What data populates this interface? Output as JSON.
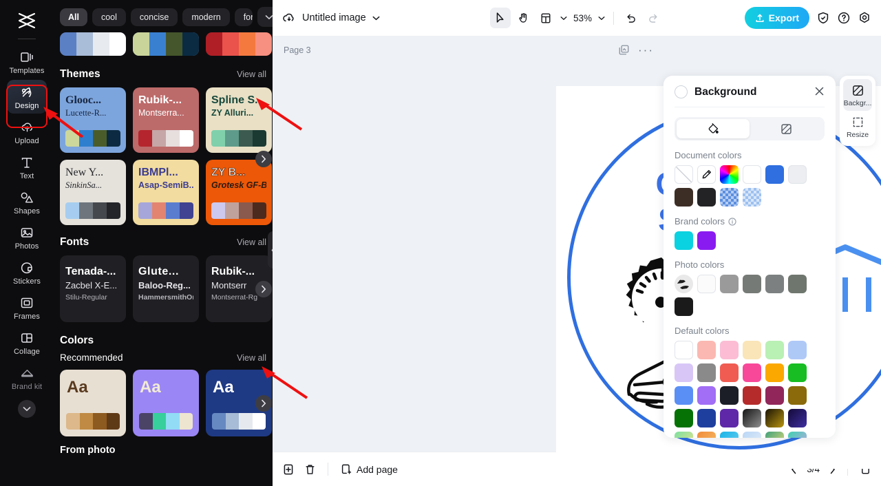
{
  "rail": {
    "logo_icon": "capcut-logo-icon",
    "items": [
      {
        "label": "Templates",
        "icon": "templates-icon",
        "active": false
      },
      {
        "label": "Design",
        "icon": "design-icon",
        "active": true
      },
      {
        "label": "Upload",
        "icon": "upload-cloud-icon",
        "active": false
      },
      {
        "label": "Text",
        "icon": "text-icon",
        "active": false
      },
      {
        "label": "Shapes",
        "icon": "shapes-icon",
        "active": false
      },
      {
        "label": "Photos",
        "icon": "photos-icon",
        "active": false
      },
      {
        "label": "Stickers",
        "icon": "stickers-icon",
        "active": false
      },
      {
        "label": "Frames",
        "icon": "frames-icon",
        "active": false
      },
      {
        "label": "Collage",
        "icon": "collage-icon",
        "active": false
      },
      {
        "label": "Brand kit",
        "icon": "brand-kit-icon",
        "active": false
      }
    ],
    "expand_icon": "chevron-down-icon"
  },
  "panel": {
    "chips": [
      {
        "label": "All",
        "selected": true
      },
      {
        "label": "cool",
        "selected": false
      },
      {
        "label": "concise",
        "selected": false
      },
      {
        "label": "modern",
        "selected": false
      },
      {
        "label": "formal",
        "selected": false
      }
    ],
    "chip_more_icon": "chevron-down-icon",
    "cutoff_cards": [
      {
        "colors": [
          "#5b80c4",
          "#a9bcd8",
          "#e7eaef",
          "#ffffff"
        ],
        "frame": "#27387f"
      },
      {
        "colors": [
          "#c9d49a",
          "#3a80d0",
          "#46562c",
          "#0b2b43"
        ],
        "frame": "#89bbe8"
      },
      {
        "colors": [
          "#b01f26",
          "#e9534c",
          "#f4793f",
          "#f79080"
        ],
        "frame": "#8d1014"
      }
    ],
    "themes": {
      "title": "Themes",
      "view_all": "View all",
      "cards": [
        {
          "name1": "Glooc...",
          "name2": "Lucette-R...",
          "bg": "#7da5dd",
          "fg1": "#17263f",
          "fg2": "#17263f",
          "serif": true,
          "swatch": [
            "#ccd79b",
            "#2f7fcf",
            "#4a5c29",
            "#0c2b42"
          ]
        },
        {
          "name1": "Rubik-...",
          "name2": "Montserra...",
          "bg": "#bd6a6a",
          "fg1": "#ffffff",
          "fg2": "#ffffff",
          "serif": false,
          "swatch": [
            "#b5252d",
            "#c6a6a6",
            "#e7dede",
            "#ffffff"
          ]
        },
        {
          "name1": "Spline S...",
          "name2": "ZY Alluri...",
          "bg": "#e9e0c5",
          "fg1": "#17483c",
          "fg2": "#17483c",
          "serif": false,
          "swatch": [
            "#7fd0ab",
            "#5e9b8a",
            "#3c5a50",
            "#1a3a32"
          ]
        },
        {
          "name1": "New Y...",
          "name2": "SinkinSa...",
          "bg": "#e5e2dc",
          "fg1": "#26262a",
          "fg2": "#26262a",
          "serif": true,
          "swatch": [
            "#a6cdf0",
            "#6e757c",
            "#45484d",
            "#242529"
          ]
        },
        {
          "name1": "IBMPl...",
          "name2": "Asap-SemiB...",
          "bg": "#f2dc9f",
          "fg1": "#3b3c91",
          "fg2": "#3b3c91",
          "serif": false,
          "swatch": [
            "#a6a6da",
            "#e28470",
            "#5a7dd0",
            "#3f4391"
          ]
        },
        {
          "name1": "ZY B...",
          "name2": "Grotesk GF-B...",
          "bg": "#ec5807",
          "fg1": "#f6eee9",
          "fg2": "#2b1a12",
          "serif": false,
          "swatch": [
            "#cdc9ee",
            "#c0a29c",
            "#8a5a4e",
            "#4c2a1e"
          ]
        }
      ],
      "next_icon": "chevron-right-icon"
    },
    "fonts": {
      "title": "Fonts",
      "view_all": "View all",
      "cards": [
        {
          "l1": "Tenada-...",
          "l2": "Zacbel X-E...",
          "l3": "Stilu-Regular"
        },
        {
          "l1": "Glute...",
          "l2": "Baloo-Reg...",
          "l3": "HammersmithOn..."
        },
        {
          "l1": "Rubik-...",
          "l2": "Montserr",
          "l3": "Montserrat-Rg"
        }
      ],
      "next_icon": "chevron-right-icon"
    },
    "colors": {
      "title": "Colors",
      "recommended_label": "Recommended",
      "view_all": "View all",
      "cards": [
        {
          "aa": "Aa",
          "bg": "#e8dfd3",
          "fg": "#5a3b1f",
          "swatch": [
            "#ddb88a",
            "#c08a44",
            "#8d5a20",
            "#5f3a17"
          ]
        },
        {
          "aa": "Aa",
          "bg": "#9b86f5",
          "fg": "#f2ebd6",
          "swatch": [
            "#4b4467",
            "#37cf9b",
            "#92dcf6",
            "#eee5d0"
          ]
        },
        {
          "aa": "Aa",
          "bg": "#1f3a84",
          "fg": "#ffffff",
          "swatch": [
            "#6689c2",
            "#a7bcd6",
            "#e6eaef",
            "#ffffff"
          ]
        }
      ],
      "next_icon": "chevron-right-icon",
      "from_photo": "From photo"
    },
    "collapse_icon": "chevron-left-icon"
  },
  "topbar": {
    "cloud_icon": "cloud-save-icon",
    "doc_title": "Untitled image",
    "title_caret_icon": "chevron-down-icon",
    "tools": [
      {
        "name": "select-tool",
        "icon": "cursor-icon",
        "selected": true
      },
      {
        "name": "hand-tool",
        "icon": "hand-icon",
        "selected": false
      },
      {
        "name": "layout-tool",
        "icon": "layout-icon",
        "selected": false
      }
    ],
    "zoom": "53%",
    "zoom_caret_icon": "chevron-down-icon",
    "undo_icon": "undo-icon",
    "redo_icon": "redo-icon",
    "export_label": "Export",
    "export_icon": "upload-icon",
    "export_color": "#16c4e5",
    "right_icons": [
      "shield-check-icon",
      "help-circle-icon",
      "settings-gear-icon"
    ]
  },
  "canvas": {
    "page_label": "Page 3",
    "duplicate_icon": "duplicate-page-icon",
    "more_icon": "more-horizontal-icon",
    "logo": {
      "title_line1": "Car Garage",
      "title_line2": "Shop Logo",
      "ring_color": "#2f6fe0",
      "text_color": "#3b72e8",
      "garage_color": "#4a90f0",
      "art_icons": [
        "gear-speedometer-icon",
        "sports-car-icon",
        "garage-building-icon"
      ]
    }
  },
  "bottombar": {
    "duplicate_icon": "duplicate-icon",
    "delete_icon": "trash-icon",
    "add_page_label": "Add page",
    "add_page_icon": "add-page-icon",
    "prev_icon": "chevron-left-icon",
    "next_icon": "chevron-right-icon",
    "page_indicator": "3/4",
    "expand_icon": "expand-panel-icon"
  },
  "props": {
    "title": "Background",
    "close_icon": "close-icon",
    "tabs": [
      {
        "name": "fill-tab",
        "icon": "paint-bucket-icon",
        "on": true
      },
      {
        "name": "transparency-tab",
        "icon": "checker-square-icon",
        "on": false
      }
    ],
    "document_colors_label": "Document colors",
    "document_colors": [
      {
        "type": "none",
        "color": "#ffffff"
      },
      {
        "type": "eyedropper",
        "color": "#ffffff"
      },
      {
        "type": "rainbow",
        "color": "rainbow"
      },
      {
        "type": "solid",
        "color": "#ffffff"
      },
      {
        "type": "solid",
        "color": "#2f6fe0"
      },
      {
        "type": "solid",
        "color": "#eceef1"
      },
      {
        "type": "solid",
        "color": "#3d2e25"
      },
      {
        "type": "solid",
        "color": "#232326"
      },
      {
        "type": "checker",
        "color": "#5b8fe0"
      },
      {
        "type": "checker",
        "color": "#9dc0ef"
      }
    ],
    "brand_colors_label": "Brand colors",
    "brand_info_icon": "info-icon",
    "brand_colors": [
      "#0ad2e0",
      "#8a1bf0"
    ],
    "photo_colors_label": "Photo colors",
    "photo_colors": [
      {
        "type": "thumb",
        "color": "#d8d8d8"
      },
      {
        "type": "solid",
        "color": "#fbfbfb"
      },
      {
        "type": "solid",
        "color": "#9a9a9a"
      },
      {
        "type": "solid",
        "color": "#767a76"
      },
      {
        "type": "solid",
        "color": "#7c8080"
      },
      {
        "type": "solid",
        "color": "#6f766e"
      },
      {
        "type": "solid",
        "color": "#1a1a1a"
      }
    ],
    "default_colors_label": "Default colors",
    "default_colors": [
      [
        "#ffffff",
        "#fbb8b2",
        "#fbbcd4",
        "#fae5b8",
        "#b9f0b4",
        "#afc9f7",
        "#d8c6f7"
      ],
      [
        "#8a8a8a",
        "#f05c52",
        "#f8489a",
        "#fba800",
        "#17bd22",
        "#5a8ff5",
        "#a16ef5"
      ],
      [
        "#1b1e26",
        "#b52b2b",
        "#91265a",
        "#8a6a0a",
        "#067206",
        "#1f3f9e",
        "#5e28a8"
      ],
      [
        "linear-gradient(135deg,#151515,#8f8f8f)",
        "linear-gradient(135deg,#1a1405,#b89410)",
        "linear-gradient(135deg,#140a3a,#3e2fa0)",
        "linear-gradient(135deg,#7ce0a0,#f0e48a)",
        "linear-gradient(135deg,#f08a3a,#f6c36a)",
        "linear-gradient(135deg,#18b4e8,#6fd0f0)",
        "linear-gradient(135deg,#b9d6f5,#e6eef9)"
      ],
      [
        "linear-gradient(135deg,#3fa07a,#f0e07a)",
        "linear-gradient(135deg,#3fd0b0,#c6a6e8)",
        "linear-gradient(135deg,#8a3ff0,#3fb4f0)",
        "linear-gradient(135deg,#b93fd0,#f06a9a)",
        "linear-gradient(135deg,#f06a5a,#f2a0b8)",
        "linear-gradient(135deg,#6aa0e8,#f0e07a)",
        "linear-gradient(135deg,#a06ad0,#e88a8a)"
      ]
    ]
  },
  "side_tools": [
    {
      "label": "Backgr...",
      "icon": "background-icon",
      "on": true
    },
    {
      "label": "Resize",
      "icon": "resize-icon",
      "on": false
    }
  ]
}
